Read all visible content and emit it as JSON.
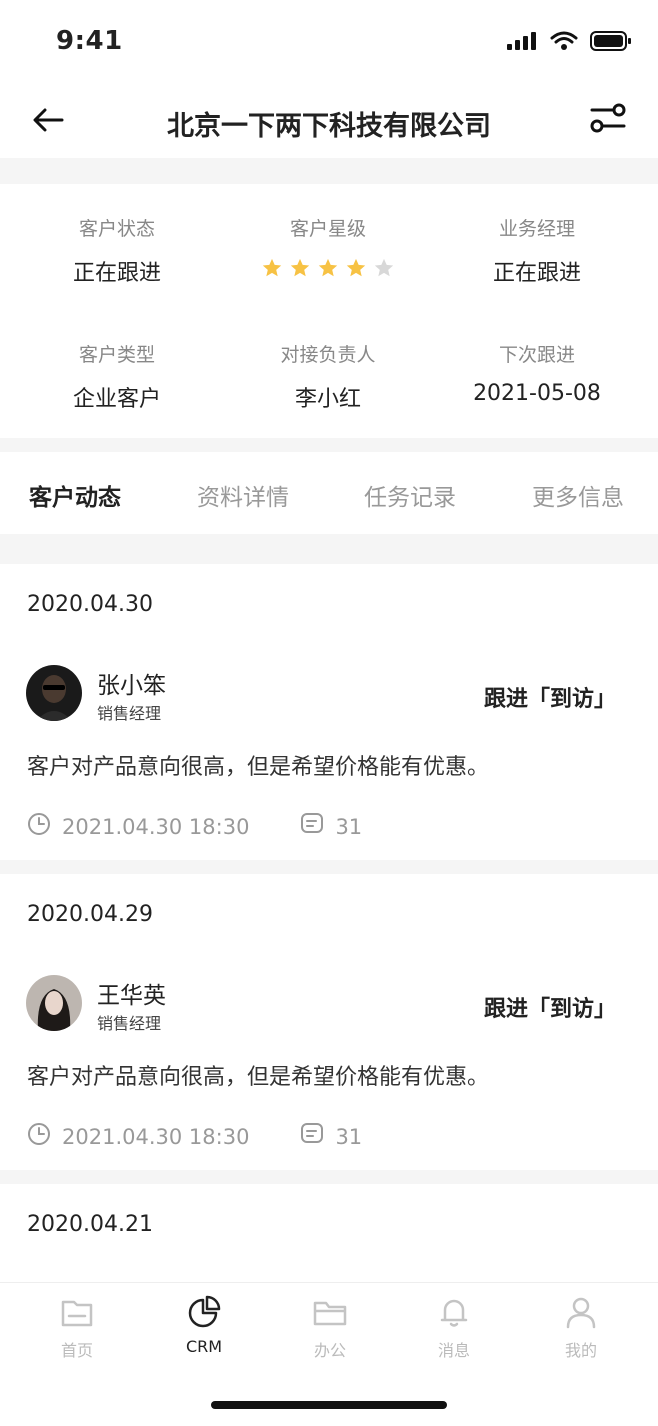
{
  "status": {
    "time": "9:41"
  },
  "nav": {
    "title": "北京一下两下科技有限公司"
  },
  "summary": {
    "status_label": "客户状态",
    "status_value": "正在跟进",
    "stars_label": "客户星级",
    "stars_value": 4,
    "stars_max": 5,
    "manager_label": "业务经理",
    "manager_value": "正在跟进",
    "type_label": "客户类型",
    "type_value": "企业客户",
    "contact_label": "对接负责人",
    "contact_value": "李小红",
    "next_label": "下次跟进",
    "next_value": "2021-05-08"
  },
  "tabs": [
    "客户动态",
    "资料详情",
    "任务记录",
    "更多信息"
  ],
  "activities": [
    {
      "date": "2020.04.30",
      "name": "张小笨",
      "role": "销售经理",
      "followup": "跟进「到访」",
      "content": "客户对产品意向很高，但是希望价格能有优惠。",
      "time": "2021.04.30 18:30",
      "comments": "31"
    },
    {
      "date": "2020.04.29",
      "name": "王华英",
      "role": "销售经理",
      "followup": "跟进「到访」",
      "content": "客户对产品意向很高，但是希望价格能有优惠。",
      "time": "2021.04.30 18:30",
      "comments": "31"
    },
    {
      "date": "2020.04.21"
    }
  ],
  "tabbar": [
    "首页",
    "CRM",
    "办公",
    "消息",
    "我的"
  ],
  "colors": {
    "star": "#f7c244",
    "star_empty": "#d8d8d8",
    "accent_text": "#222222"
  }
}
